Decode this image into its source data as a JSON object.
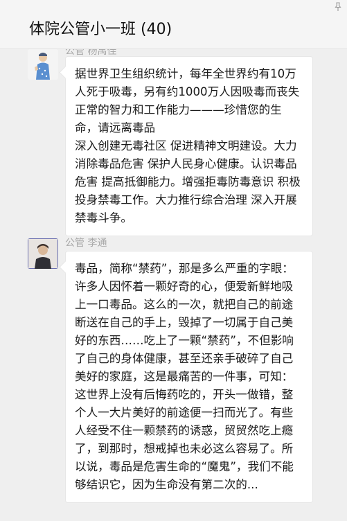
{
  "header": {
    "title": "体院公管小一班 (40)",
    "pin_icon": "pin-icon"
  },
  "messages": [
    {
      "sender": "公管  杨禹佳",
      "text": "据世界卫生组织统计，每年全世界约有10万人死于吸毒，另有约1000万人因吸毒而丧失正常的智力和工作能力———珍惜您的生命，请远离毒品\n深入创建无毒社区 促进精神文明建设。大力消除毒品危害 保护人民身心健康。认识毒品危害 提高抵御能力。增强拒毒防毒意识 积极投身禁毒工作。大力推行综合治理 深入开展禁毒斗争。"
    },
    {
      "sender": "公管  李通",
      "text": "毒品，简称“禁药”，那是多么严重的字眼：许多人因怀着一颗好奇的心，便爱新鲜地吸上一口毒品。这么的一次，就把自己的前途断送在自己的手上，毁掉了一切属于自己美好的东西……吃上了一颗“禁药”，不但影响了自己的身体健康，甚至还亲手破碎了自己美好的家庭，这是最痛苦的一件事，可知：这世界上没有后悔药吃的，开头一做错，整个人一大片美好的前途便一扫而光了。有些人经受不住一颗禁药的诱惑，贸贸然吃上瘾了，到那时，想戒掉也未必这么容易了。所以说，毒品是危害生命的“魔鬼”，我们不能够结识它，因为生命没有第二次的..."
    }
  ],
  "colors": {
    "background": "#efefef",
    "bubble": "#ffffff",
    "sender_text": "#a8a8a8"
  }
}
